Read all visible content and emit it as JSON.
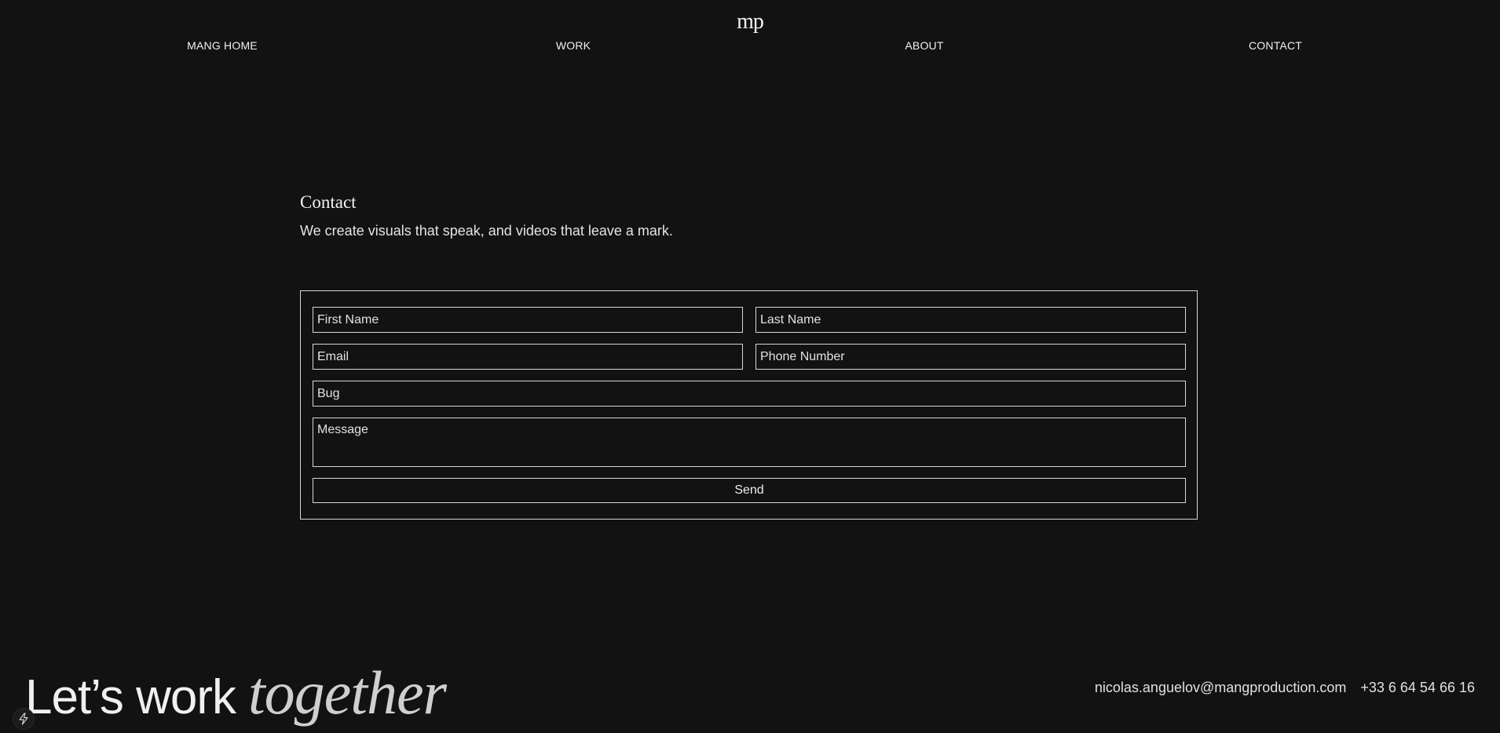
{
  "brand": {
    "logo_text": "mp"
  },
  "nav": {
    "items": [
      {
        "label": "MANG HOME"
      },
      {
        "label": "WORK"
      },
      {
        "label": "ABOUT"
      },
      {
        "label": "CONTACT"
      }
    ]
  },
  "intro": {
    "title": "Contact",
    "subtitle": "We create visuals that speak, and videos that leave a mark."
  },
  "form": {
    "first_name": {
      "placeholder": "First Name",
      "value": ""
    },
    "last_name": {
      "placeholder": "Last Name",
      "value": ""
    },
    "email": {
      "placeholder": "Email",
      "value": ""
    },
    "phone": {
      "placeholder": "Phone Number",
      "value": ""
    },
    "subject": {
      "placeholder": "Bug",
      "value": ""
    },
    "message": {
      "placeholder": "Message",
      "value": ""
    },
    "send_label": "Send"
  },
  "footer": {
    "cta_plain": "Let’s work",
    "cta_italic": "together",
    "email": "nicolas.anguelov@mangproduction.com",
    "phone": "+33 6 64 54 66 16"
  },
  "icons": {
    "badge": "lightning-bolt-icon"
  },
  "colors": {
    "background": "#121212",
    "text": "#f0f0f0",
    "border": "#d8d8d8",
    "accent_italic": "#cfcfcf"
  }
}
